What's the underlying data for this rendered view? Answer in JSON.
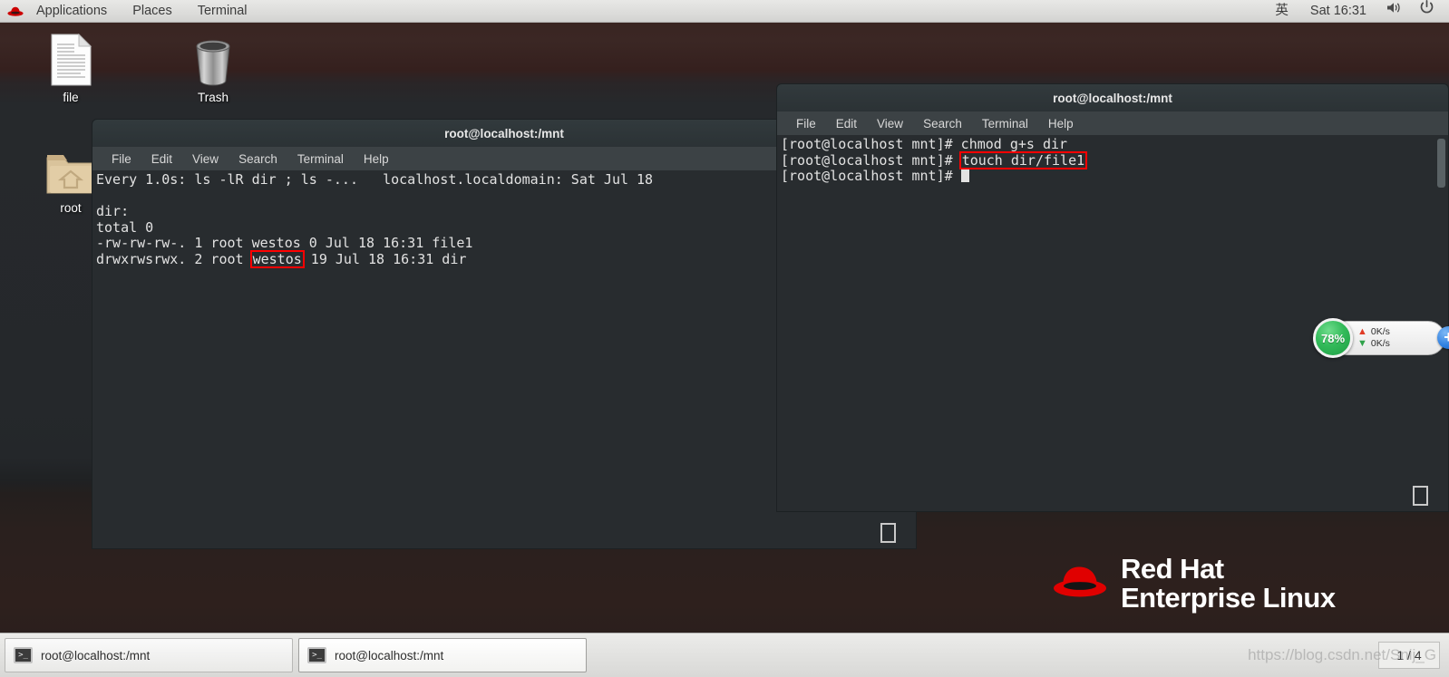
{
  "top_panel": {
    "logo_icon": "redhat-logo-icon",
    "menus": [
      "Applications",
      "Places",
      "Terminal"
    ],
    "input_method": "英",
    "clock": "Sat 16:31",
    "volume_icon": "speaker-icon",
    "power_icon": "power-icon"
  },
  "desktop_icons": [
    {
      "label": "file",
      "icon": "document-icon"
    },
    {
      "label": "Trash",
      "icon": "trash-icon"
    },
    {
      "label": "root",
      "icon": "home-folder-icon"
    }
  ],
  "windows": {
    "left_terminal": {
      "title": "root@localhost:/mnt",
      "menus": [
        "File",
        "Edit",
        "View",
        "Search",
        "Terminal",
        "Help"
      ],
      "lines": [
        "Every 1.0s: ls -lR dir ; ls -...   localhost.localdomain: Sat Jul 18",
        "",
        "dir:",
        "total 0",
        "-rw-rw-rw-. 1 root westos 0 Jul 18 16:31 file1"
      ],
      "highlighted_line": {
        "prefix": "drwxrwsrwx. 2 root ",
        "highlight": "westos",
        "suffix": " 19 Jul 18 16:31 dir"
      }
    },
    "right_terminal": {
      "title": "root@localhost:/mnt",
      "menus": [
        "File",
        "Edit",
        "View",
        "Search",
        "Terminal",
        "Help"
      ],
      "line1": "[root@localhost mnt]# chmod g+s dir",
      "line2_prompt": "[root@localhost mnt]# ",
      "line2_highlight": "touch dir/file1",
      "line3_prompt": "[root@localhost mnt]# "
    }
  },
  "brand": {
    "line1": "Red Hat",
    "line2": "Enterprise Linux",
    "hat_icon": "redhat-fedora-icon"
  },
  "netspeed": {
    "percent": "78%",
    "up_arrow": "▲",
    "down_arrow": "▼",
    "up_rate": "0K/s",
    "down_rate": "0K/s",
    "add_label": "+",
    "circle_color": "#33bb5a",
    "up_color": "#e03b26",
    "down_color": "#2fa24a"
  },
  "taskbar": {
    "buttons": [
      {
        "label": "root@localhost:/mnt",
        "icon": "terminal-icon"
      },
      {
        "label": "root@localhost:/mnt",
        "icon": "terminal-icon"
      }
    ],
    "workspace": "1 / 4",
    "watermark": "https://blog.csdn.net/Snij_G"
  }
}
